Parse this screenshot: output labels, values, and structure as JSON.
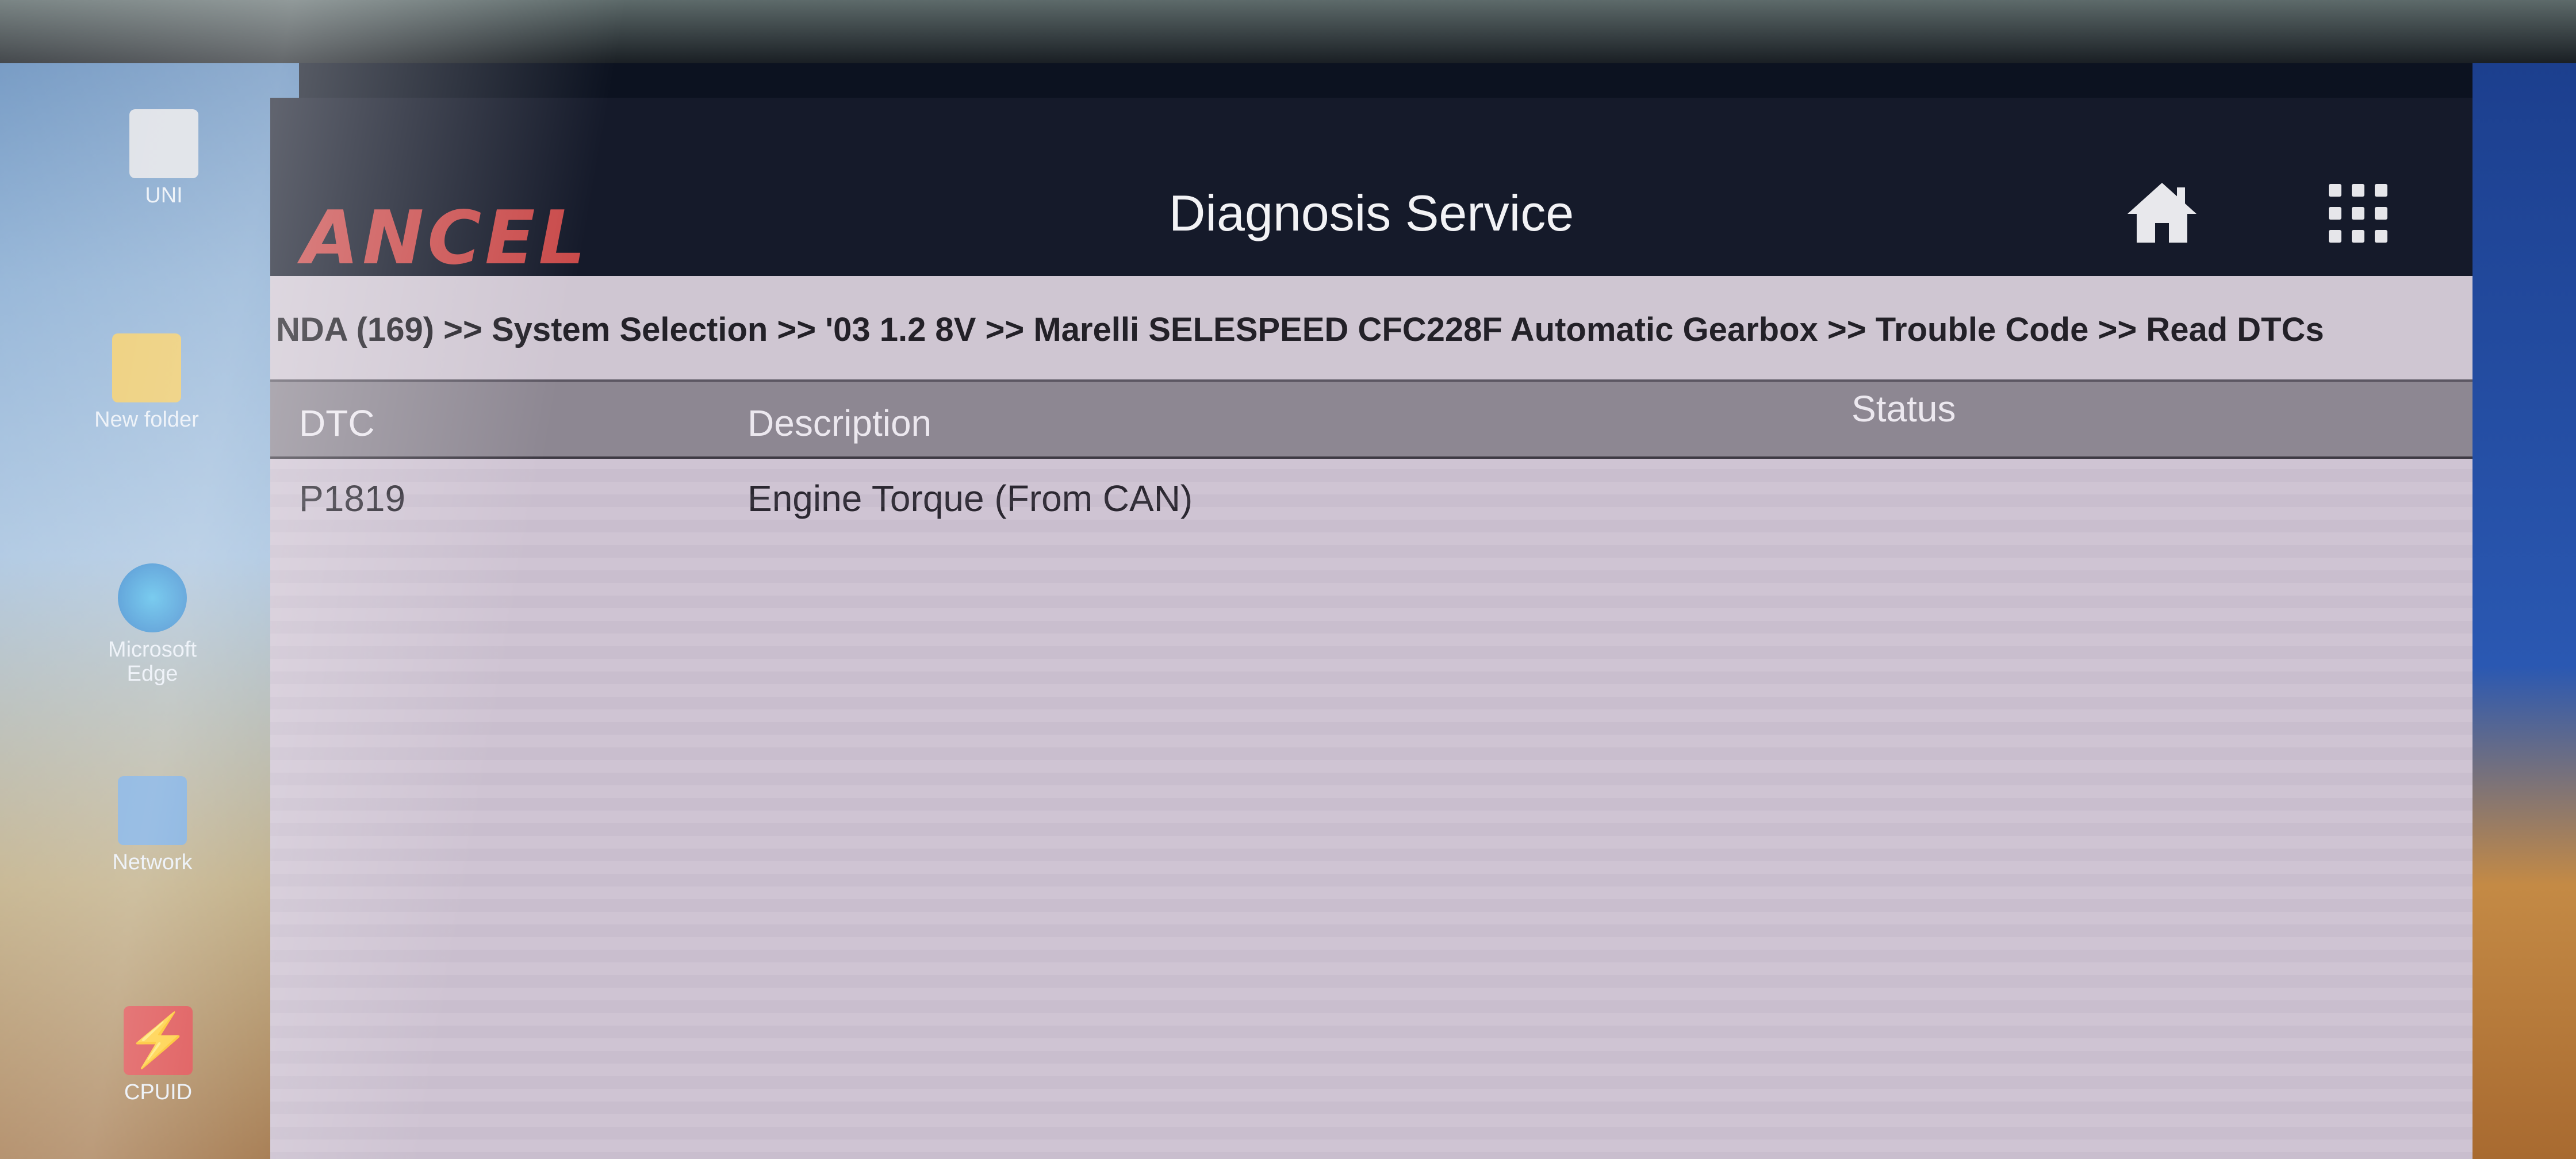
{
  "desktop": {
    "icons": [
      {
        "label": "UNI",
        "name": "uni-icon"
      },
      {
        "label": "New folder",
        "name": "new-folder-icon"
      },
      {
        "label": "Microsoft Edge",
        "name": "microsoft-edge-icon"
      },
      {
        "label": "Network",
        "name": "network-icon"
      },
      {
        "label": "CPUID",
        "name": "cpuid-icon"
      }
    ]
  },
  "app": {
    "logo": "ANCEL",
    "title": "Diagnosis Service",
    "breadcrumb": "NDA (169) >> System Selection >> '03 1.2 8V >> Marelli SELESPEED CFC228F Automatic Gearbox >> Trouble Code >> Read DTCs",
    "table": {
      "headers": {
        "dtc": "DTC",
        "description": "Description",
        "status": "Status"
      },
      "rows": [
        {
          "dtc": "P1819",
          "description": "Engine Torque (From CAN)",
          "status": ""
        }
      ]
    }
  },
  "colors": {
    "header_bg": "#151a2a",
    "content_bg": "#cfc4d3",
    "table_header_bg": "#8d8792",
    "logo_red": "#c94a4a"
  }
}
